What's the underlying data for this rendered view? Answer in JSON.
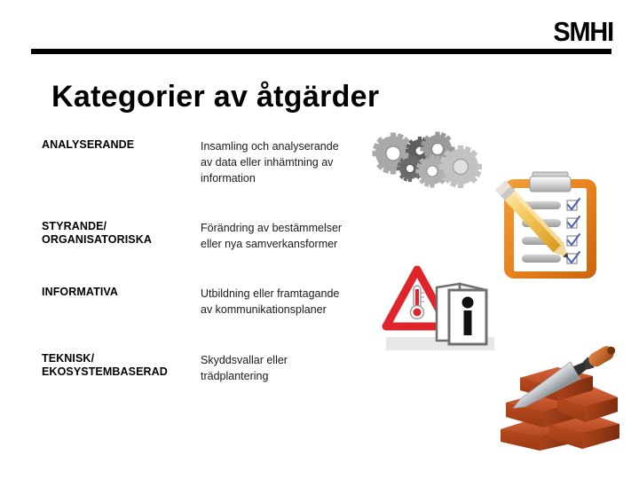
{
  "header": {
    "logo_text": "SMHI"
  },
  "title": "Kategorier av åtgärder",
  "table": {
    "rows": [
      {
        "category_line1": "ANALYSERANDE",
        "category_line2": "",
        "description": "Insamling och analyserande av data eller inhämtning av information"
      },
      {
        "category_line1": "STYRANDE/",
        "category_line2": "ORGANISATORISKA",
        "description": "Förändring av bestämmelser eller nya samverkansformer"
      },
      {
        "category_line1": "INFORMATIVA",
        "category_line2": "",
        "description": "Utbildning eller framtagande av kommunikationsplaner"
      },
      {
        "category_line1": "TEKNISK/",
        "category_line2": "EKOSYSTEMBASERAD",
        "description": "Skyddsvallar eller trädplantering"
      }
    ]
  },
  "artwork": {
    "gears": "gears-illustration",
    "clipboard": "clipboard-pencil-checklist-illustration",
    "warning_info": "warning-thermometer-info-brochure-illustration",
    "bricks": "bricks-trowel-illustration"
  },
  "colors": {
    "rule": "#000000",
    "text": "#000000",
    "gear_light": "#b3b3b3",
    "gear_mid": "#8c8c8c",
    "gear_dark": "#575757",
    "clipboard_orange": "#e8821e",
    "clipboard_orange_dark": "#c9640c",
    "pencil_yellow": "#f4c453",
    "check_blue": "#4a5fb5",
    "warning_red": "#e0242b",
    "brick_red": "#c1481f",
    "brick_red_dark": "#8e3213",
    "steel": "#b9bcc0",
    "ground_gray": "#e6e6e6"
  }
}
